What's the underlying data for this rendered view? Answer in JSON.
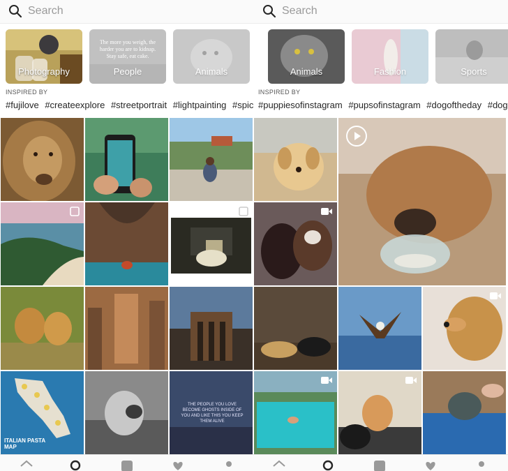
{
  "left": {
    "search": {
      "placeholder": "Search"
    },
    "topics": [
      {
        "label": "Photography"
      },
      {
        "label": "People",
        "overlay_text": "The more you weigh, the harder you are to kidnap. Stay safe, eat cake."
      },
      {
        "label": "Animals"
      }
    ],
    "inspired_label": "INSPIRED BY",
    "hashtags": [
      "#fujilove",
      "#createexplore",
      "#streetportrait",
      "#lightpainting",
      "#spico"
    ],
    "neon_sign": "THE PEOPLE YOU LOVE BECOME GHOSTS INSIDE OF YOU AND LIKE THIS YOU KEEP THEM ALIVE",
    "map_title": "ITALIAN PASTA MAP"
  },
  "right": {
    "search": {
      "placeholder": "Search"
    },
    "topics": [
      {
        "label": "Animals"
      },
      {
        "label": "Fashion"
      },
      {
        "label": "Sports"
      }
    ],
    "inspired_label": "INSPIRED BY",
    "hashtags": [
      "#puppiesofinstagram",
      "#pupsofinstagram",
      "#dogoftheday",
      "#dogs"
    ]
  },
  "colors": {
    "text": "#262626",
    "placeholder": "#9a9a9a",
    "tabbar": "#fafafa"
  },
  "icons": [
    "search-icon",
    "multi-photo-icon",
    "video-icon",
    "play-icon",
    "home-icon",
    "heart-icon",
    "profile-icon",
    "add-post-icon"
  ]
}
